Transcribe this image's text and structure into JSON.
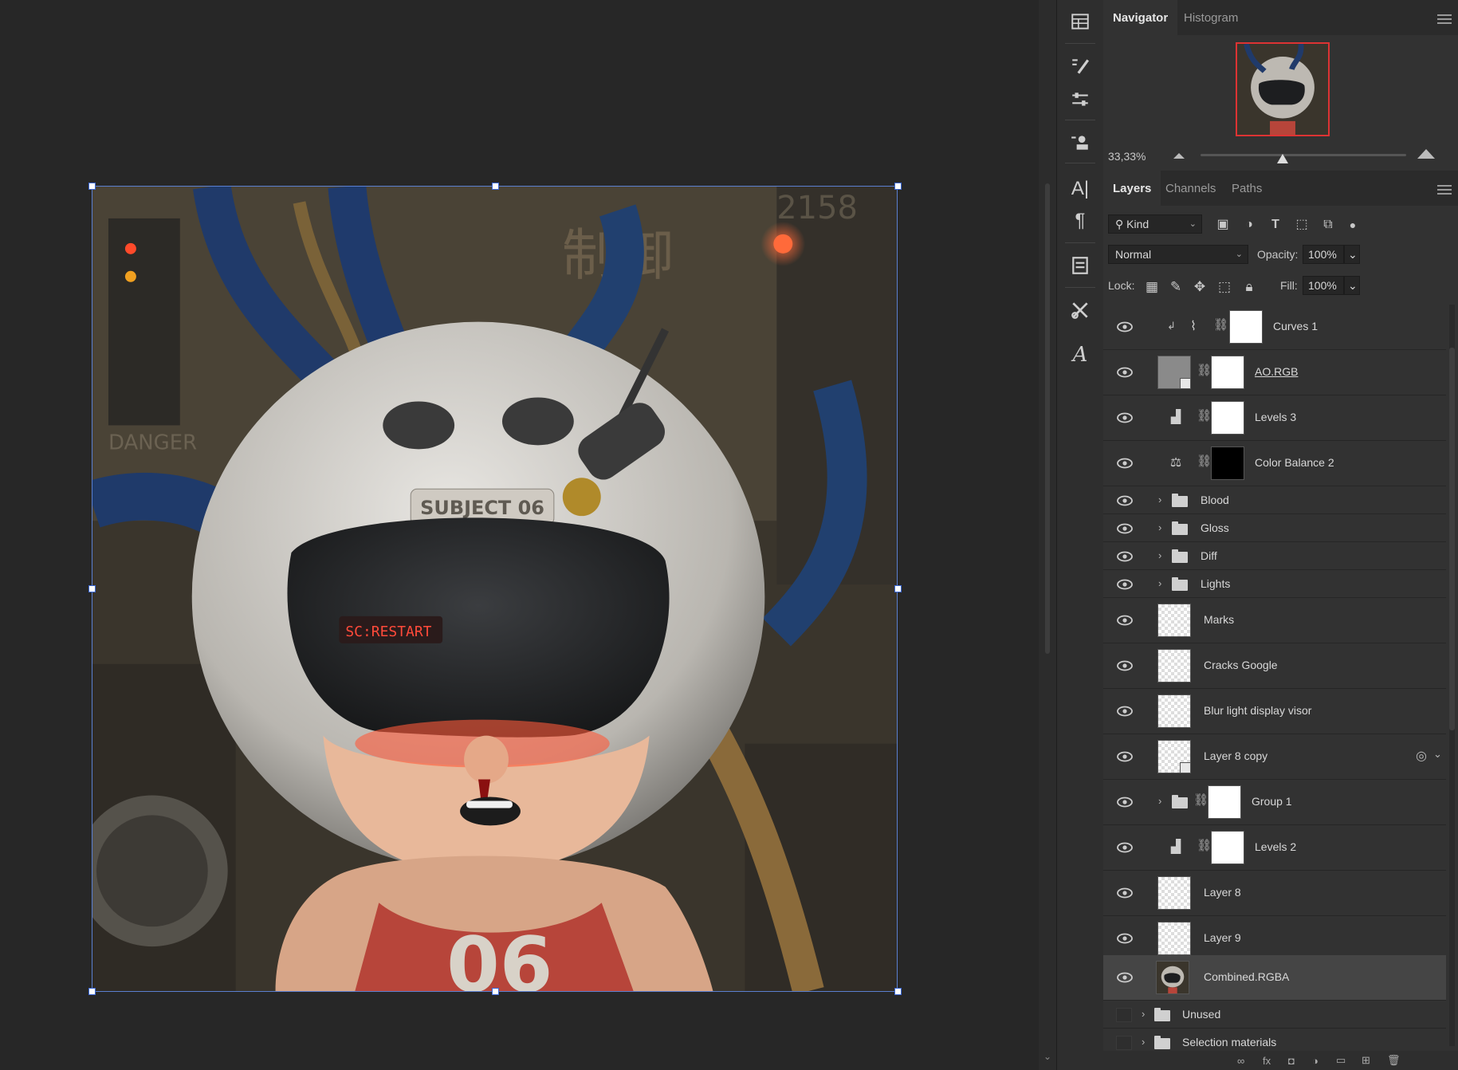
{
  "navigator": {
    "tabs": [
      "Navigator",
      "Histogram"
    ],
    "zoom": "33,33%",
    "zoom_slider_fraction": 0.4
  },
  "layers_panel": {
    "tabs": [
      "Layers",
      "Channels",
      "Paths"
    ],
    "filter_kind": "Kind",
    "blend_mode": "Normal",
    "opacity_label": "Opacity:",
    "opacity": "100%",
    "lock_label": "Lock:",
    "fill_label": "Fill:",
    "fill": "100%",
    "layers": [
      {
        "name": "Curves 1",
        "type": "adjustment-curves"
      },
      {
        "name": "AO.RGB",
        "type": "smart-object-masked"
      },
      {
        "name": "Levels 3",
        "type": "adjustment-levels"
      },
      {
        "name": "Color Balance 2",
        "type": "adjustment-color-balance"
      },
      {
        "name": "Blood",
        "type": "group"
      },
      {
        "name": "Gloss",
        "type": "group"
      },
      {
        "name": "Diff",
        "type": "group"
      },
      {
        "name": "Lights",
        "type": "group"
      },
      {
        "name": "Marks",
        "type": "pixel"
      },
      {
        "name": "Cracks Google",
        "type": "pixel"
      },
      {
        "name": "Blur light display visor",
        "type": "pixel"
      },
      {
        "name": "Layer 8 copy",
        "type": "smart-object"
      },
      {
        "name": "Group 1",
        "type": "group-masked"
      },
      {
        "name": "Levels 2",
        "type": "adjustment-levels"
      },
      {
        "name": "Layer 8",
        "type": "pixel"
      },
      {
        "name": "Layer 9",
        "type": "pixel"
      },
      {
        "name": "Combined.RGBA",
        "type": "image",
        "selected": true
      },
      {
        "name": "Unused",
        "type": "group-hidden"
      },
      {
        "name": "Selection materials",
        "type": "group-hidden"
      }
    ]
  },
  "artwork": {
    "helmet_text": "SUBJECT 06",
    "visor_text": "SC:RESTART",
    "shirt_text": "06",
    "sign_text": "制御",
    "warning_text": "DANGER",
    "corner_number": "2158"
  },
  "colors": {
    "selection_border": "#5a7fd0",
    "navigator_frame": "#dd3333"
  }
}
